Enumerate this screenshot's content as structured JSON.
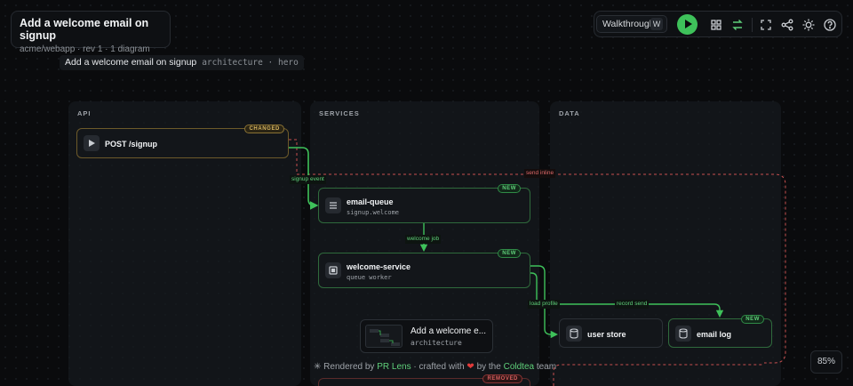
{
  "header": {
    "title": "Add a welcome email on signup",
    "subtitle": "acme/webapp · rev 1 · 1 diagram"
  },
  "toolbar": {
    "walkthrough_label": "Walkthrough",
    "walkthrough_key": "W",
    "icons": [
      "play-icon",
      "grid-icon",
      "swap-icon",
      "fullscreen-icon",
      "share-icon",
      "theme-icon",
      "help-icon"
    ]
  },
  "diagram": {
    "name": "Add a welcome email on signup",
    "tags": "architecture · hero"
  },
  "lanes": {
    "api": "API",
    "services": "SERVICES",
    "data": "DATA"
  },
  "nodes": {
    "signup": {
      "title": "POST /signup",
      "badge": "CHANGED"
    },
    "email_queue": {
      "title": "email-queue",
      "sub": "signup.welcome",
      "badge": "NEW"
    },
    "welcome_service": {
      "title": "welcome-service",
      "sub": "queue worker",
      "badge": "NEW"
    },
    "user_store": {
      "title": "user store"
    },
    "email_log": {
      "title": "email log",
      "badge": "NEW"
    },
    "removed_node": {
      "badge": "REMOVED"
    }
  },
  "edges": {
    "signup_event": "signup event",
    "welcome_job": "welcome job",
    "load_profile": "load profile",
    "record_send": "record send",
    "send_inline": "send inline"
  },
  "preview": {
    "title": "Add a welcome e...",
    "sub": "architecture"
  },
  "footer": {
    "prefix": "Rendered by",
    "brand": "PR Lens",
    "middle": "· crafted with",
    "by": "by the",
    "team": "Coldtea",
    "suffix": "team"
  },
  "zoom": "85%",
  "colors": {
    "accent_green": "#3ec15a",
    "changed": "#d8b660",
    "removed": "#e06a6a",
    "background": "#0a0b0d"
  }
}
